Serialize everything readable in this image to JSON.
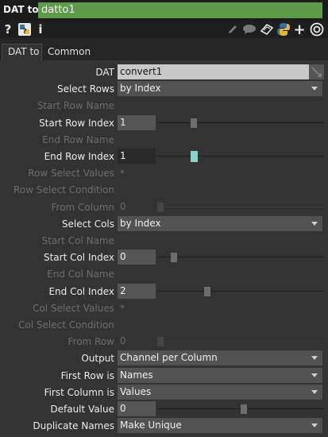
{
  "header": {
    "op_type": "DAT to",
    "op_name": "datto1",
    "accent": "#5f9a4a"
  },
  "toolbar": {
    "icons": [
      "help-icon",
      "python-help-icon",
      "info-icon",
      "pencil-icon",
      "comment-icon",
      "clone-icon",
      "python-icon",
      "add-icon",
      "viewer-icon"
    ],
    "help_glyph": "?",
    "info_glyph": "i",
    "add_glyph": "+"
  },
  "tabs": [
    {
      "label": "DAT to",
      "active": true
    },
    {
      "label": "Common",
      "active": false
    }
  ],
  "params": [
    {
      "label": "DAT",
      "type": "text",
      "value": "convert1",
      "enabled": true
    },
    {
      "label": "Select Rows",
      "type": "menu",
      "value": "by Index",
      "enabled": true
    },
    {
      "label": "Start Row Name",
      "type": "empty",
      "enabled": false
    },
    {
      "label": "Start Row Index",
      "type": "slider",
      "value": "1",
      "enabled": true,
      "fraction": 0.2
    },
    {
      "label": "End Row  Name",
      "type": "empty",
      "enabled": false
    },
    {
      "label": "End Row Index",
      "type": "slider",
      "value": "1",
      "enabled": true,
      "fraction": 0.2,
      "highlight": true
    },
    {
      "label": "Row Select Values",
      "type": "star",
      "value": "*",
      "enabled": false
    },
    {
      "label": "Row Select Condition",
      "type": "empty",
      "enabled": false
    },
    {
      "label": "From Column",
      "type": "slider",
      "value": "0",
      "enabled": false,
      "fraction": 0.0
    },
    {
      "label": "Select Cols",
      "type": "menu",
      "value": "by Index",
      "enabled": true
    },
    {
      "label": "Start Col Name",
      "type": "empty",
      "enabled": false
    },
    {
      "label": "Start Col Index",
      "type": "slider",
      "value": "0",
      "enabled": true,
      "fraction": 0.08
    },
    {
      "label": "End Col Name",
      "type": "empty",
      "enabled": false
    },
    {
      "label": "End Col Index",
      "type": "slider",
      "value": "2",
      "enabled": true,
      "fraction": 0.28
    },
    {
      "label": "Col Select Values",
      "type": "star",
      "value": "*",
      "enabled": false
    },
    {
      "label": "Col Select Condition",
      "type": "empty",
      "enabled": false
    },
    {
      "label": "From Row",
      "type": "slider",
      "value": "0",
      "enabled": false,
      "fraction": 0.0
    },
    {
      "label": "Output",
      "type": "menu",
      "value": "Channel per Column",
      "enabled": true
    },
    {
      "label": "First Row is",
      "type": "menu",
      "value": "Names",
      "enabled": true
    },
    {
      "label": "First Column is",
      "type": "menu",
      "value": "Values",
      "enabled": true
    },
    {
      "label": "Default Value",
      "type": "slider",
      "value": "0",
      "enabled": true,
      "fraction": 0.5
    },
    {
      "label": "Duplicate Names",
      "type": "menu",
      "value": "Make Unique",
      "enabled": true
    }
  ]
}
